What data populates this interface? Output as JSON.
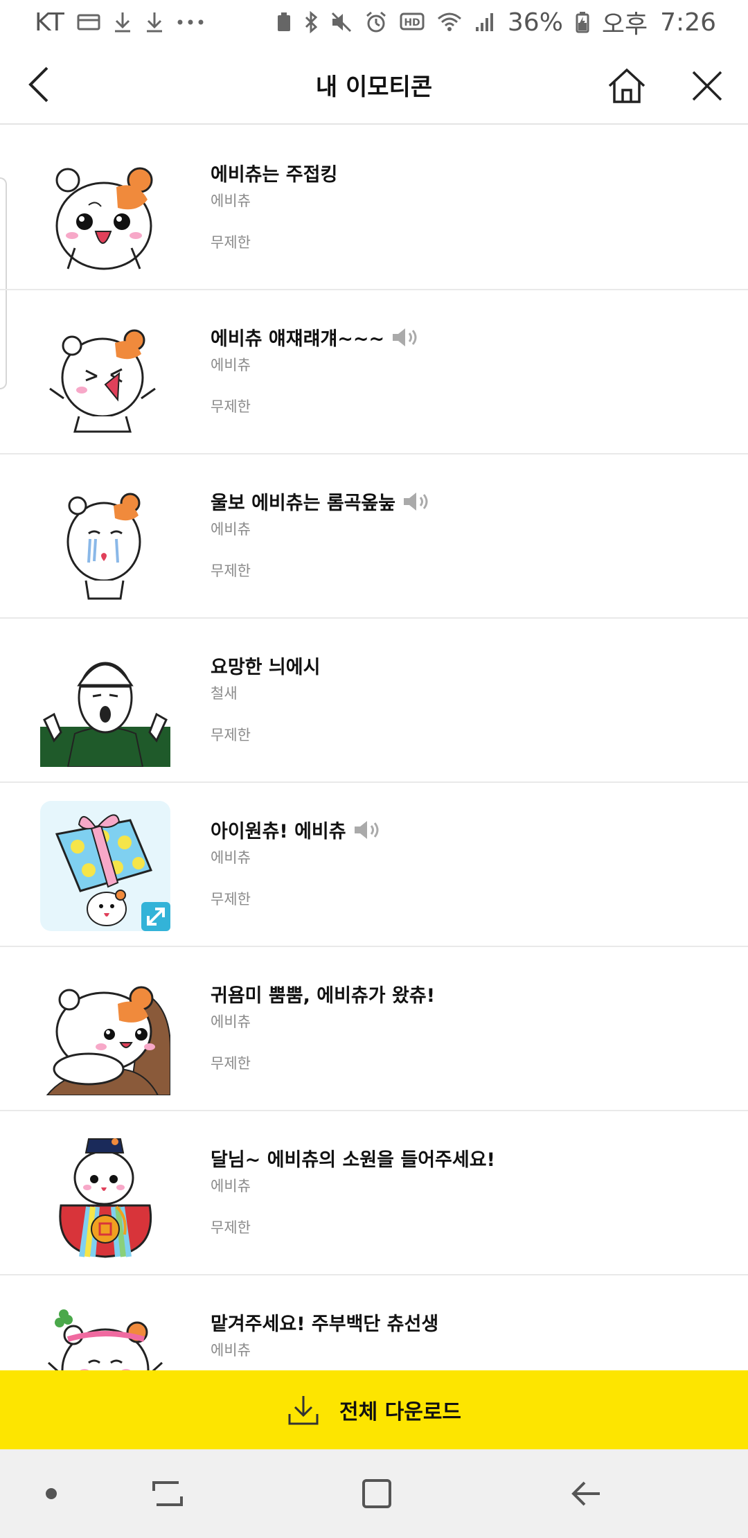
{
  "status_bar": {
    "carrier": "KT",
    "battery": "36%",
    "ampm": "오후",
    "time": "7:26"
  },
  "header": {
    "title": "내 이모티콘"
  },
  "items": [
    {
      "title": "에비츄는 주접킹",
      "author": "에비츄",
      "period": "무제한",
      "sound": false,
      "thumb": "hamster-surprised"
    },
    {
      "title": "에비츄 얘쟤럐걔~~~",
      "author": "에비츄",
      "period": "무제한",
      "sound": true,
      "thumb": "hamster-shouting"
    },
    {
      "title": "울보 에비츄는 롬곡옾눞",
      "author": "에비츄",
      "period": "무제한",
      "sound": true,
      "thumb": "hamster-crying"
    },
    {
      "title": "요망한 늬에시",
      "author": "철새",
      "period": "무제한",
      "sound": false,
      "thumb": "man-green-shirt"
    },
    {
      "title": "아이원츄! 에비츄",
      "author": "에비츄",
      "period": "무제한",
      "sound": true,
      "thumb": "gift-box",
      "badge": "expand-icon"
    },
    {
      "title": "귀욤미 뿜뿜, 에비츄가 왔츄!",
      "author": "에비츄",
      "period": "무제한",
      "sound": false,
      "thumb": "hamster-peeking"
    },
    {
      "title": "달님~ 에비츄의 소원을 들어주세요!",
      "author": "에비츄",
      "period": "무제한",
      "sound": false,
      "thumb": "hamster-lucky-bag"
    },
    {
      "title": "맡겨주세요! 주부백단 츄선생",
      "author": "에비츄",
      "period": "",
      "sound": false,
      "thumb": "hamster-housewife"
    }
  ],
  "download": {
    "label": "전체 다운로드"
  },
  "colors": {
    "accent_yellow": "#fde500",
    "hamster_orange": "#f08a3c",
    "sweater_green": "#1f5a2a",
    "gift_blue": "#7fd0f0"
  }
}
